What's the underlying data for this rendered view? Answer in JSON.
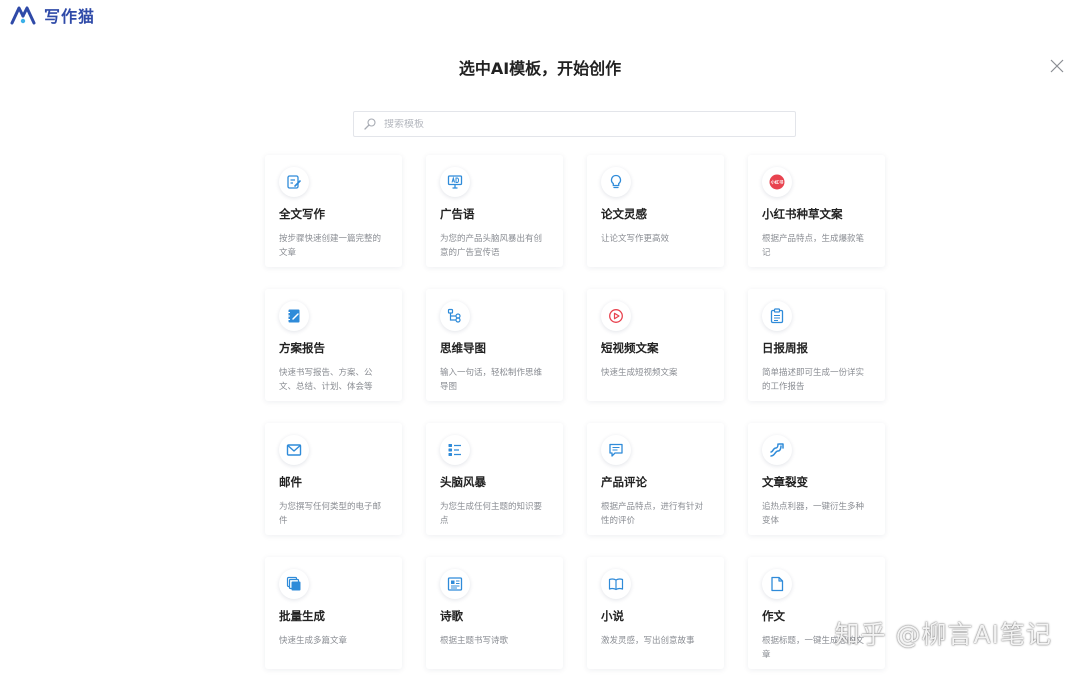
{
  "app": {
    "logo_text": "写作猫"
  },
  "dialog": {
    "title": "选中AI模板，开始创作",
    "search_placeholder": "搜索模板"
  },
  "templates": [
    {
      "name": "全文写作",
      "desc": "按步骤快速创建一篇完整的文章",
      "icon": "edit-icon"
    },
    {
      "name": "广告语",
      "desc": "为您的产品头脑风暴出有创意的广告宣传语",
      "icon": "ad-billboard-icon"
    },
    {
      "name": "论文灵感",
      "desc": "让论文写作更高效",
      "icon": "lightbulb-icon"
    },
    {
      "name": "小红书种草文案",
      "desc": "根据产品特点，生成爆款笔记",
      "icon": "xiaohongshu-icon",
      "badge": "小红书"
    },
    {
      "name": "方案报告",
      "desc": "快速书写报告、方案、公文、总结、计划、体会等",
      "icon": "notebook-icon"
    },
    {
      "name": "思维导图",
      "desc": "输入一句话，轻松制作思维导图",
      "icon": "mindmap-icon"
    },
    {
      "name": "短视频文案",
      "desc": "快速生成短视频文案",
      "icon": "play-video-icon"
    },
    {
      "name": "日报周报",
      "desc": "简单描述即可生成一份详实的工作报告",
      "icon": "clipboard-icon"
    },
    {
      "name": "邮件",
      "desc": "为您撰写任何类型的电子邮件",
      "icon": "mail-icon"
    },
    {
      "name": "头脑风暴",
      "desc": "为您生成任何主题的知识要点",
      "icon": "list-icon"
    },
    {
      "name": "产品评论",
      "desc": "根据产品特点，进行有针对性的评价",
      "icon": "comment-icon"
    },
    {
      "name": "文章裂变",
      "desc": "追热点利器，一键衍生多种变体",
      "icon": "split-arrow-icon"
    },
    {
      "name": "批量生成",
      "desc": "快速生成多篇文章",
      "icon": "stack-pages-icon"
    },
    {
      "name": "诗歌",
      "desc": "根据主题书写诗歌",
      "icon": "newspaper-icon"
    },
    {
      "name": "小说",
      "desc": "激发灵感，写出创意故事",
      "icon": "book-icon"
    },
    {
      "name": "作文",
      "desc": "根据标题，一键生成您的文章",
      "icon": "document-icon"
    }
  ],
  "watermark": "知乎 @柳言AI笔记",
  "colors": {
    "accent": "#2f8bd9",
    "brand": "#2f4aa8",
    "xiaohongshu": "#e8434f"
  }
}
